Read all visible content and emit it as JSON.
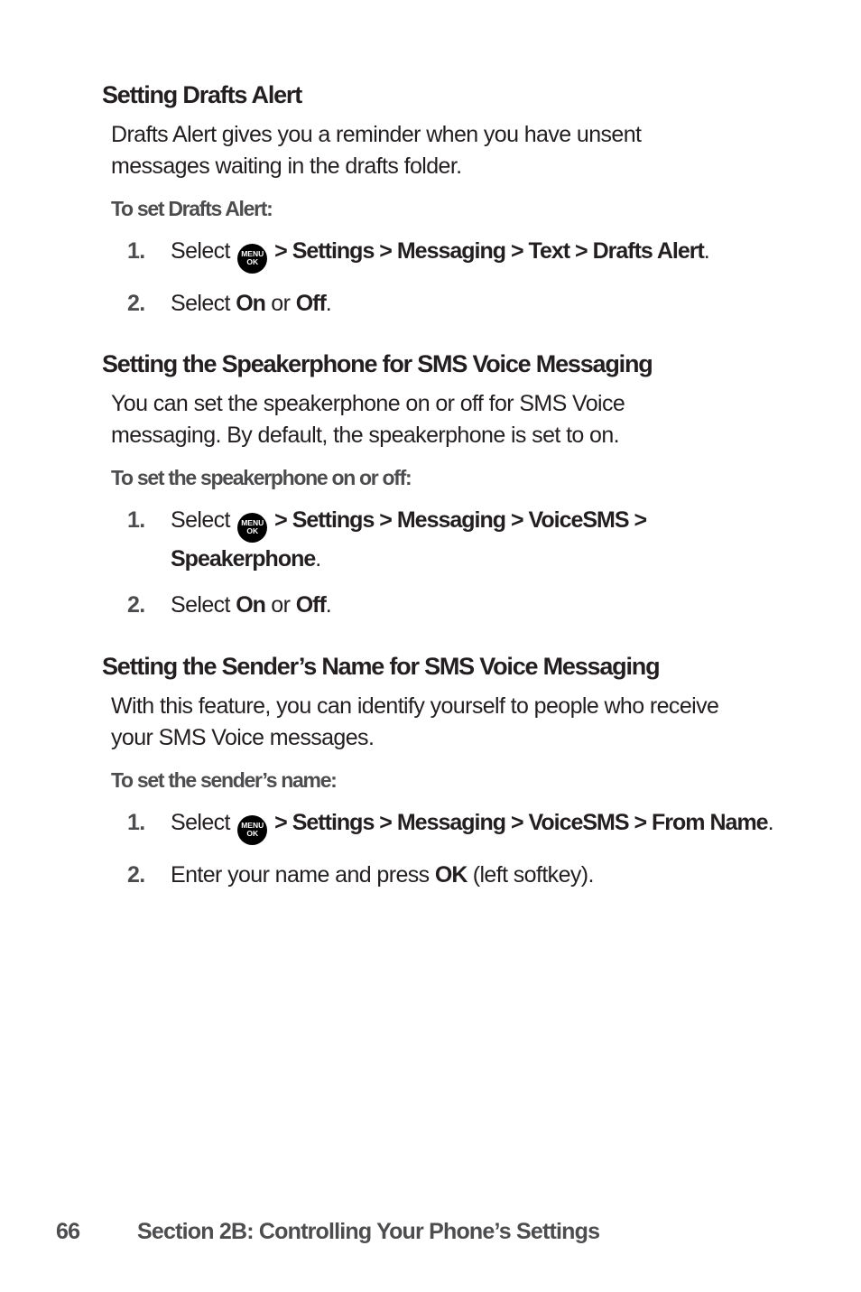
{
  "sections": [
    {
      "heading": "Setting Drafts Alert",
      "description": "Drafts Alert gives you a reminder when you have unsent messages waiting in the drafts folder.",
      "procedure_label": "To set Drafts Alert:",
      "steps": [
        {
          "number": "1.",
          "prefix": "Select ",
          "icon": "menu-ok-icon",
          "path": " > Settings > Messaging > Text > Drafts Alert",
          "suffix": "."
        },
        {
          "number": "2.",
          "prefix": "Select ",
          "option_a": "On",
          "middle": " or ",
          "option_b": "Off",
          "suffix": "."
        }
      ]
    },
    {
      "heading": "Setting the Speakerphone for SMS Voice Messaging",
      "description": "You can set the speakerphone on or off for SMS Voice messaging. By default, the speakerphone is set to on.",
      "procedure_label": "To set the speakerphone on or off:",
      "steps": [
        {
          "number": "1.",
          "prefix": "Select ",
          "icon": "menu-ok-icon",
          "path": " > Settings > Messaging > VoiceSMS > Speakerphone",
          "suffix": "."
        },
        {
          "number": "2.",
          "prefix": "Select ",
          "option_a": "On",
          "middle": " or ",
          "option_b": "Off",
          "suffix": "."
        }
      ]
    },
    {
      "heading": "Setting the Sender’s Name for SMS Voice Messaging",
      "description": "With this feature, you can identify yourself to people who receive your SMS Voice messages.",
      "procedure_label": "To set the sender’s name:",
      "steps": [
        {
          "number": "1.",
          "prefix": "Select ",
          "icon": "menu-ok-icon",
          "path": " > Settings > Messaging > VoiceSMS > From Name",
          "suffix": "."
        },
        {
          "number": "2.",
          "prefix": "Enter your name and press ",
          "key": "OK",
          "suffix": " (left softkey)."
        }
      ]
    }
  ],
  "menu_icon": {
    "line1": "MENU",
    "line2": "OK"
  },
  "footer": {
    "page_number": "66",
    "section_title": "Section 2B: Controlling Your Phone’s Settings"
  }
}
